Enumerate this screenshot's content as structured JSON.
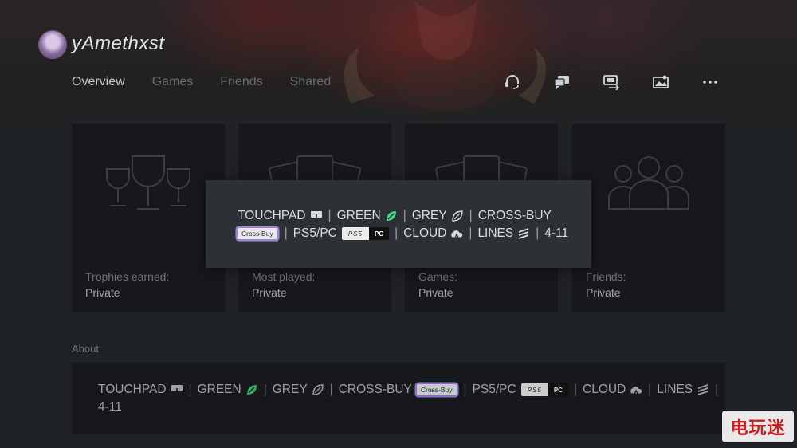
{
  "profile": {
    "username": "yAmethxst"
  },
  "tabs": [
    {
      "label": "Overview",
      "active": true
    },
    {
      "label": "Games",
      "active": false
    },
    {
      "label": "Friends",
      "active": false
    },
    {
      "label": "Shared",
      "active": false
    }
  ],
  "actions": [
    {
      "icon": "headset-icon"
    },
    {
      "icon": "message-icon"
    },
    {
      "icon": "share-screen-icon"
    },
    {
      "icon": "media-icon"
    },
    {
      "icon": "more-icon"
    }
  ],
  "tiles": [
    {
      "label": "Trophies earned:",
      "value": "Private",
      "icon": "trophies-icon"
    },
    {
      "label": "Most played:",
      "value": "Private",
      "icon": "cards-icon"
    },
    {
      "label": "Games:",
      "value": "Private",
      "icon": "cards-icon"
    },
    {
      "label": "Friends:",
      "value": "Private",
      "icon": "friends-icon"
    }
  ],
  "overlay": {
    "touchpad": "TOUCHPAD",
    "green": "GREEN",
    "grey": "GREY",
    "crossbuy": "CROSS-BUY",
    "crossbuy_badge": "Cross-Buy",
    "ps5pc": "PS5/PC",
    "ps5_badge": "PS5",
    "pc_badge": "PC",
    "cloud": "CLOUD",
    "lines": "LINES",
    "range": "4-11"
  },
  "about": {
    "heading": "About",
    "touchpad": "TOUCHPAD",
    "green": "GREEN",
    "grey": "GREY",
    "crossbuy": "CROSS-BUY",
    "crossbuy_badge": "Cross-Buy",
    "ps5pc": "PS5/PC",
    "ps5_badge": "PS5",
    "pc_badge": "PC",
    "cloud": "CLOUD",
    "lines": "LINES",
    "range": "4-11"
  },
  "watermark": "电玩迷",
  "colors": {
    "accent_green": "#3ddc84",
    "background": "#1e2125",
    "tile": "#16181b"
  }
}
